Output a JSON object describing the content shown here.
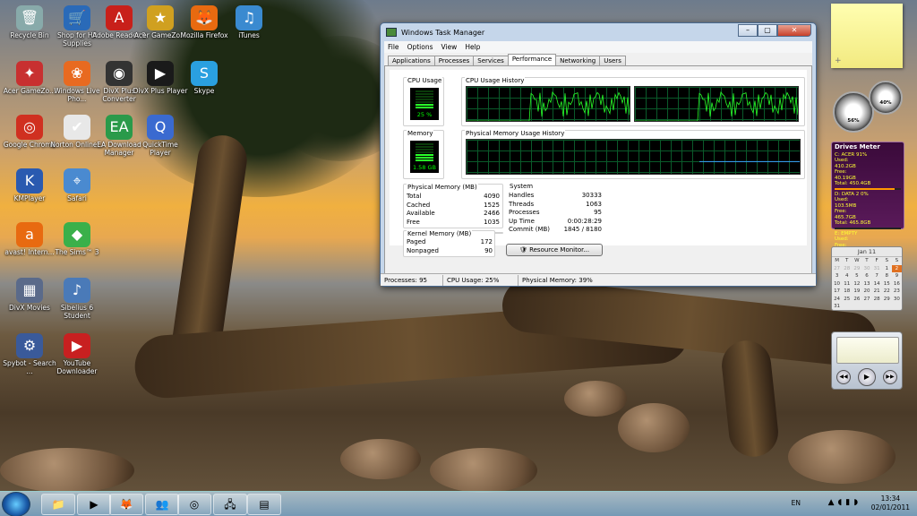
{
  "desktop_icons": [
    {
      "label": "Recycle Bin",
      "glyph": "🗑",
      "color": "#8aa"
    },
    {
      "label": "Shop for HP Supplies",
      "glyph": "🛒",
      "color": "#2a6ab8"
    },
    {
      "label": "Adobe Reader 9",
      "glyph": "A",
      "color": "#c8201a"
    },
    {
      "label": "Acer GameZo...",
      "glyph": "★",
      "color": "#d0a020"
    },
    {
      "label": "Mozilla Firefox",
      "glyph": "🦊",
      "color": "#e86a10"
    },
    {
      "label": "iTunes",
      "glyph": "♫",
      "color": "#3a8ad0"
    },
    {
      "label": "Acer GameZo...",
      "glyph": "✦",
      "color": "#c83030"
    },
    {
      "label": "Windows Live Pho...",
      "glyph": "❀",
      "color": "#e86a20"
    },
    {
      "label": "DivX Plus Converter",
      "glyph": "◉",
      "color": "#333"
    },
    {
      "label": "DivX Plus Player",
      "glyph": "▶",
      "color": "#1a1a1a"
    },
    {
      "label": "Skype",
      "glyph": "S",
      "color": "#2aa0e0"
    },
    {
      "label": "Google Chrome",
      "glyph": "◎",
      "color": "#d03020"
    },
    {
      "label": "Norton Online...",
      "glyph": "✔",
      "color": "#e8e8e8"
    },
    {
      "label": "EA Download Manager",
      "glyph": "EA",
      "color": "#2a9a4a"
    },
    {
      "label": "QuickTime Player",
      "glyph": "Q",
      "color": "#3a6ad0"
    },
    {
      "label": "KMPlayer",
      "glyph": "K",
      "color": "#2a5ab0"
    },
    {
      "label": "Safari",
      "glyph": "⌖",
      "color": "#4a8ad0"
    },
    {
      "label": "avast! Intern...",
      "glyph": "a",
      "color": "#e86a10"
    },
    {
      "label": "The Sims™ 3",
      "glyph": "◆",
      "color": "#3ab04a"
    },
    {
      "label": "DivX Movies",
      "glyph": "▦",
      "color": "#5a6a8a"
    },
    {
      "label": "Sibelius 6 Student",
      "glyph": "♪",
      "color": "#4a7ab8"
    },
    {
      "label": "Spybot - Search ...",
      "glyph": "⚙",
      "color": "#3a5a9a"
    },
    {
      "label": "YouTube Downloader",
      "glyph": "▶",
      "color": "#c82020"
    }
  ],
  "task_manager": {
    "title": "Windows Task Manager",
    "menu": [
      "File",
      "Options",
      "View",
      "Help"
    ],
    "tabs": [
      "Applications",
      "Processes",
      "Services",
      "Performance",
      "Networking",
      "Users"
    ],
    "active_tab": "Performance",
    "cpu_usage_label": "CPU Usage",
    "cpu_value": "25 %",
    "cpu_fraction": 0.25,
    "cpu_history_label": "CPU Usage History",
    "memory_label": "Memory",
    "memory_value": "1.58 GB",
    "memory_fraction": 0.39,
    "mem_history_label": "Physical Memory Usage History",
    "physical_memory": {
      "title": "Physical Memory (MB)",
      "rows": [
        [
          "Total",
          "4090"
        ],
        [
          "Cached",
          "1525"
        ],
        [
          "Available",
          "2466"
        ],
        [
          "Free",
          "1035"
        ]
      ]
    },
    "kernel_memory": {
      "title": "Kernel Memory (MB)",
      "rows": [
        [
          "Paged",
          "172"
        ],
        [
          "Nonpaged",
          "90"
        ]
      ]
    },
    "system": {
      "title": "System",
      "rows": [
        [
          "Handles",
          "30333"
        ],
        [
          "Threads",
          "1063"
        ],
        [
          "Processes",
          "95"
        ],
        [
          "Up Time",
          "0:00:28:29"
        ],
        [
          "Commit (MB)",
          "1845 / 8180"
        ]
      ]
    },
    "resource_monitor_button": "Resource Monitor...",
    "status": [
      "Processes: 95",
      "CPU Usage: 25%",
      "Physical Memory: 39%"
    ],
    "window_buttons": [
      "–",
      "▢",
      "✕"
    ]
  },
  "gadgets": {
    "gauge_cpu": "56%",
    "gauge_mem": "40%",
    "drives_title": "Drives Meter",
    "drives": [
      {
        "name": "C: ACER 91%",
        "used": "Used: 410.2GB",
        "free": "Free: 40.19GB",
        "total": "Total: 450.4GB",
        "fill": 0.91
      },
      {
        "name": "D: DATA 2 0%",
        "used": "Used: 103.5MB",
        "free": "Free: 465.7GB",
        "total": "Total: 465.8GB",
        "fill": 0.0
      },
      {
        "name": "E: EMPTY",
        "used": "Used:",
        "free": "Free:",
        "total": "Total:",
        "fill": 0
      },
      {
        "name": "F: EMPTY",
        "used": "Used:",
        "free": "Free:",
        "total": "Total:",
        "fill": 0
      }
    ],
    "calendar": {
      "month": "Jan 11",
      "days": [
        "M",
        "T",
        "W",
        "T",
        "F",
        "S",
        "S"
      ],
      "weeks": [
        [
          "27",
          "28",
          "29",
          "30",
          "31",
          "1",
          "2"
        ],
        [
          "3",
          "4",
          "5",
          "6",
          "7",
          "8",
          "9"
        ],
        [
          "10",
          "11",
          "12",
          "13",
          "14",
          "15",
          "16"
        ],
        [
          "17",
          "18",
          "19",
          "20",
          "21",
          "22",
          "23"
        ],
        [
          "24",
          "25",
          "26",
          "27",
          "28",
          "29",
          "30"
        ],
        [
          "31",
          "",
          "",
          "",
          "",
          "",
          ""
        ]
      ],
      "today": "2"
    },
    "note_plus": "+"
  },
  "taskbar": {
    "items": [
      {
        "name": "explorer",
        "glyph": "📁"
      },
      {
        "name": "media-player",
        "glyph": "▶"
      },
      {
        "name": "firefox",
        "glyph": "🦊"
      },
      {
        "name": "messenger",
        "glyph": "👥"
      },
      {
        "name": "chrome",
        "glyph": "◎"
      },
      {
        "name": "network",
        "glyph": "🖧"
      },
      {
        "name": "task-manager",
        "glyph": "▤"
      }
    ],
    "language": "EN",
    "time": "13:34",
    "date": "02/01/2011"
  }
}
